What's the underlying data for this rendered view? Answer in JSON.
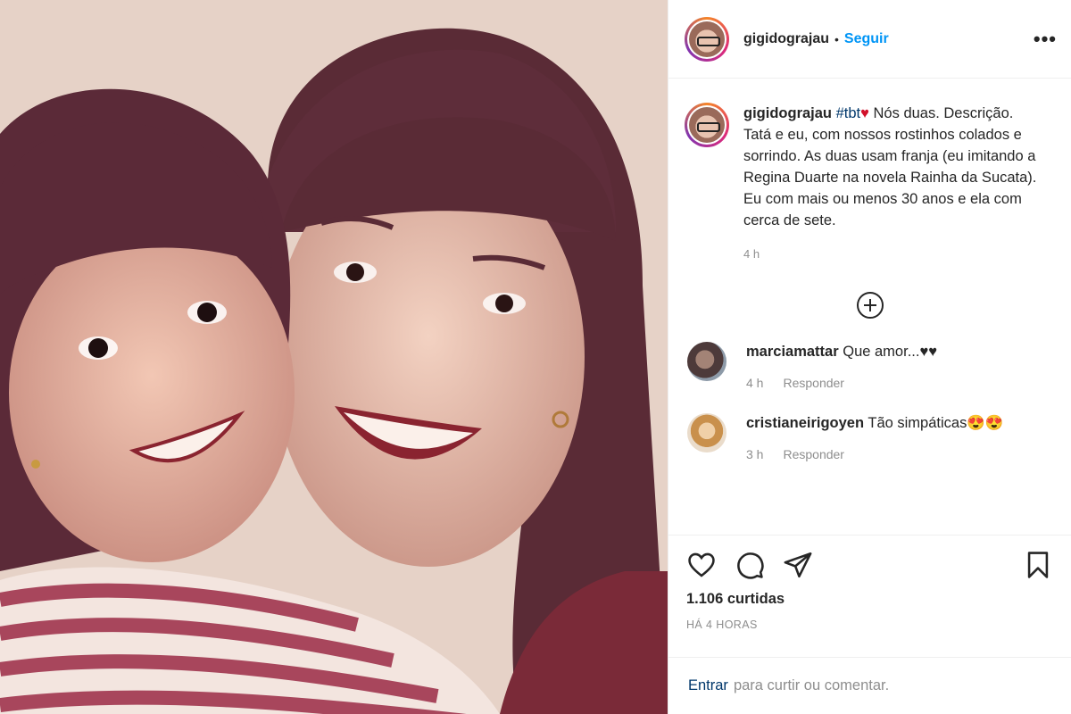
{
  "post": {
    "username": "gigidograjau",
    "follow_label": "Seguir",
    "dot": "•",
    "more_label": "•••"
  },
  "caption": {
    "username": "gigidograjau",
    "hashtag": "#tbt",
    "heart": "♥",
    "text": "Nós duas. Descrição. Tatá e eu, com nossos rostinhos colados e sorrindo. As duas usam franja (eu imitando a Regina Duarte na novela Rainha da Sucata). Eu com mais ou menos 30 anos e ela com cerca de sete.",
    "time": "4 h"
  },
  "load_more_icon": "⊕",
  "comments": [
    {
      "username": "marciamattar",
      "text": "Que amor...♥♥",
      "time": "4 h",
      "reply_label": "Responder"
    },
    {
      "username": "cristianeirigoyen",
      "text": "Tão simpáticas😍😍",
      "time": "3 h",
      "reply_label": "Responder"
    }
  ],
  "actions": {
    "like_icon": "heart-outline",
    "comment_icon": "speech-bubble",
    "share_icon": "paper-plane",
    "save_icon": "bookmark"
  },
  "likes": "1.106 curtidas",
  "posted_ago": "HÁ 4 HORAS",
  "login_prompt": {
    "link": "Entrar",
    "text": "para curtir ou comentar."
  }
}
